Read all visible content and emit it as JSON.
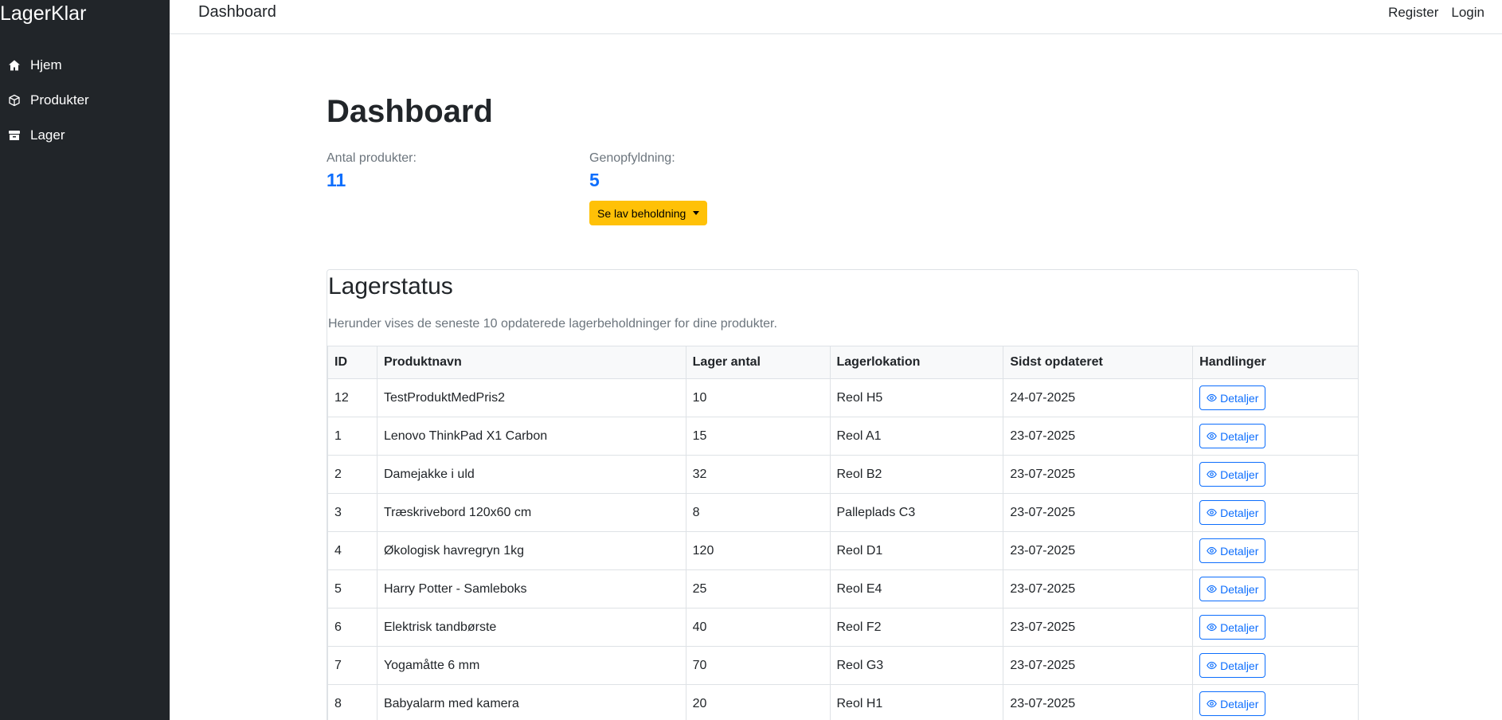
{
  "app": {
    "brand": "LagerKlar"
  },
  "sidebar": {
    "items": [
      {
        "label": "Hjem",
        "icon": "home-icon"
      },
      {
        "label": "Produkter",
        "icon": "box-icon"
      },
      {
        "label": "Lager",
        "icon": "archive-icon"
      }
    ]
  },
  "topbar": {
    "title": "Dashboard",
    "register": "Register",
    "login": "Login"
  },
  "main": {
    "title": "Dashboard",
    "stats": {
      "products_label": "Antal produkter:",
      "products_value": "11",
      "refill_label": "Genopfyldning:",
      "refill_value": "5"
    },
    "low_stock_button": "Se lav beholdning"
  },
  "stock": {
    "title": "Lagerstatus",
    "subtitle": "Herunder vises de seneste 10 opdaterede lagerbeholdninger for dine produkter.",
    "columns": [
      "ID",
      "Produktnavn",
      "Lager antal",
      "Lagerlokation",
      "Sidst opdateret",
      "Handlinger"
    ],
    "action_label": "Detaljer",
    "rows": [
      {
        "id": "12",
        "name": "TestProduktMedPris2",
        "qty": "10",
        "location": "Reol H5",
        "updated": "24-07-2025"
      },
      {
        "id": "1",
        "name": "Lenovo ThinkPad X1 Carbon",
        "qty": "15",
        "location": "Reol A1",
        "updated": "23-07-2025"
      },
      {
        "id": "2",
        "name": "Damejakke i uld",
        "qty": "32",
        "location": "Reol B2",
        "updated": "23-07-2025"
      },
      {
        "id": "3",
        "name": "Træskrivebord 120x60 cm",
        "qty": "8",
        "location": "Palleplads C3",
        "updated": "23-07-2025"
      },
      {
        "id": "4",
        "name": "Økologisk havregryn 1kg",
        "qty": "120",
        "location": "Reol D1",
        "updated": "23-07-2025"
      },
      {
        "id": "5",
        "name": "Harry Potter - Samleboks",
        "qty": "25",
        "location": "Reol E4",
        "updated": "23-07-2025"
      },
      {
        "id": "6",
        "name": "Elektrisk tandbørste",
        "qty": "40",
        "location": "Reol F2",
        "updated": "23-07-2025"
      },
      {
        "id": "7",
        "name": "Yogamåtte 6 mm",
        "qty": "70",
        "location": "Reol G3",
        "updated": "23-07-2025"
      },
      {
        "id": "8",
        "name": "Babyalarm med kamera",
        "qty": "20",
        "location": "Reol H1",
        "updated": "23-07-2025"
      }
    ]
  },
  "colors": {
    "sidebar_bg": "#212529",
    "accent": "#0d6efd",
    "warning": "#ffc107"
  }
}
